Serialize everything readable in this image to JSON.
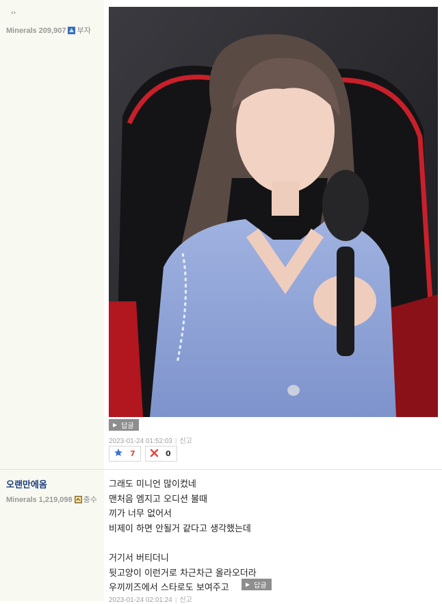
{
  "post1": {
    "tag": "‹›",
    "mineral_text": "Minerals 209,907",
    "rank": "부자",
    "reply_label": "답글",
    "timestamp": "2023-01-24 01:52:03",
    "report": "신고",
    "likes": "7",
    "dislikes": "0"
  },
  "post2": {
    "nickname": "오랜만에옴",
    "mineral_text": "Minerals 1,219,098",
    "rank": "충수",
    "lines": [
      "그래도 미니언 많이컸네",
      "맨처음 엠지고 오디션 볼때",
      "끼가 너무 없어서",
      "비제이 하면 안될거 같다고 생각했는데",
      "",
      "거기서 버티더니",
      "뒷고양이 이런거로 차근차근 올라오더라",
      "우끼끼즈에서 스타로도 보여주고"
    ],
    "reply_label": "답글",
    "timestamp": "2023-01-24 02:01:24",
    "report": "신고"
  },
  "colors": {
    "sidebar_bg": "#f8f9f1",
    "nick_color": "#1a3d7c",
    "like_color": "#e8413a",
    "star_color": "#3a6fd1"
  }
}
